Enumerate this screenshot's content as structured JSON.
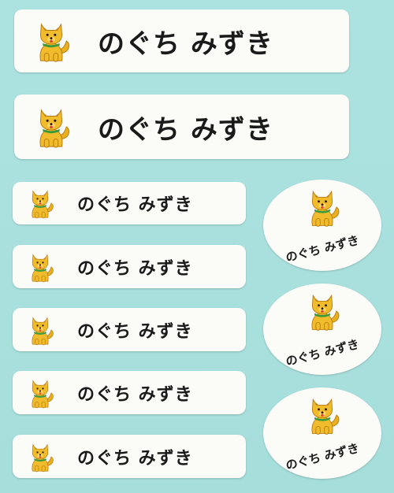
{
  "labels": {
    "large": [
      "のぐち みずき",
      "のぐち みずき"
    ],
    "small": [
      "のぐち みずき",
      "のぐち みずき",
      "のぐち みずき",
      "のぐち みずき",
      "のぐち みずき"
    ],
    "oval": [
      "のぐち みずき",
      "のぐち みずき",
      "のぐち みずき"
    ]
  },
  "icon": "dog-icon",
  "colors": {
    "background": "#a8e0dd",
    "label": "#fbfbf8",
    "dog": "#e8b020",
    "collar": "#3a9a3a"
  }
}
